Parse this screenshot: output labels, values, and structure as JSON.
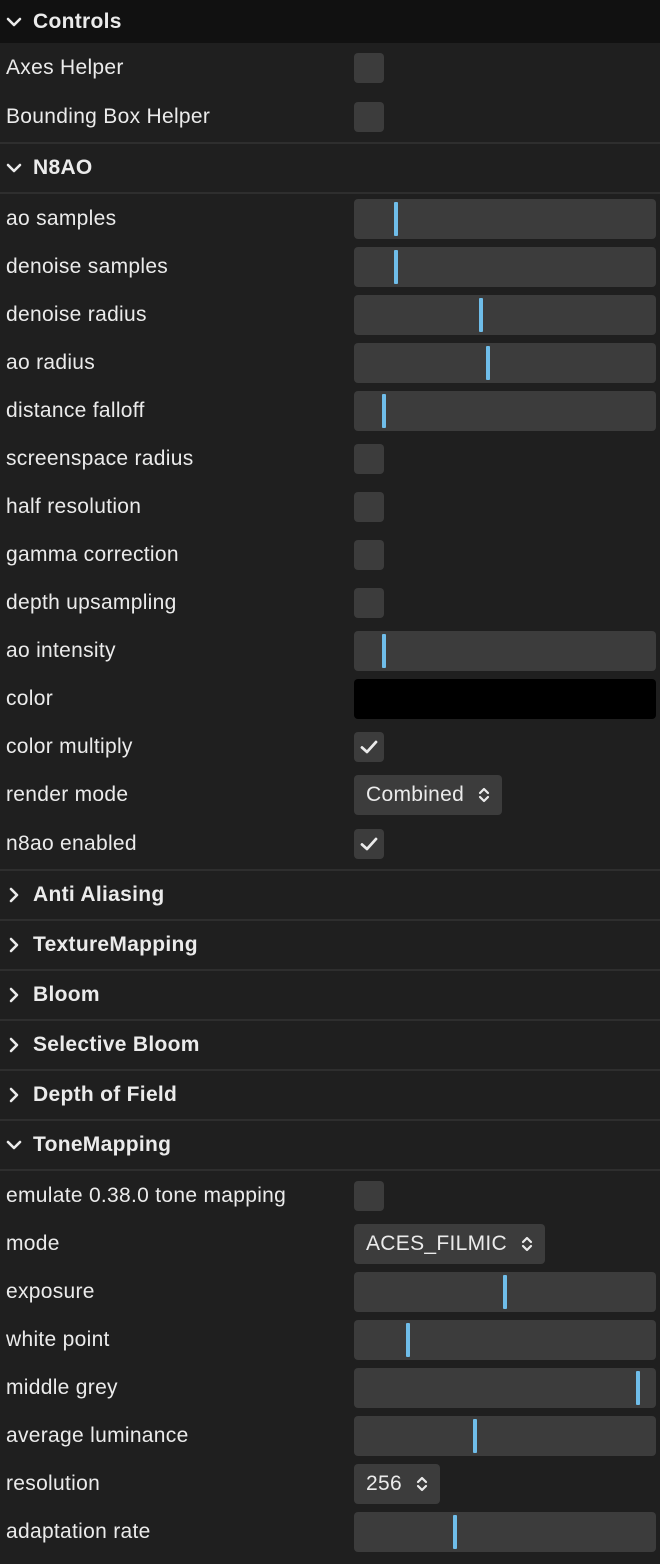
{
  "accent_color": "#6fbde9",
  "folders": {
    "controls": {
      "title": "Controls",
      "axes_helper": {
        "label": "Axes Helper",
        "checked": false
      },
      "bbox_helper": {
        "label": "Bounding Box Helper",
        "checked": false
      }
    },
    "n8ao": {
      "title": "N8AO",
      "ao_samples": {
        "label": "ao samples",
        "value_fraction": 0.14
      },
      "denoise_samples": {
        "label": "denoise samples",
        "value_fraction": 0.14
      },
      "denoise_radius": {
        "label": "denoise radius",
        "value_fraction": 0.42
      },
      "ao_radius": {
        "label": "ao radius",
        "value_fraction": 0.445
      },
      "distance_falloff": {
        "label": "distance falloff",
        "value_fraction": 0.1
      },
      "screenspace_radius": {
        "label": "screenspace radius",
        "checked": false
      },
      "half_resolution": {
        "label": "half resolution",
        "checked": false
      },
      "gamma_correction": {
        "label": "gamma correction",
        "checked": false
      },
      "depth_upsampling": {
        "label": "depth upsampling",
        "checked": false
      },
      "ao_intensity": {
        "label": "ao intensity",
        "value_fraction": 0.1
      },
      "color": {
        "label": "color",
        "value": "#000000"
      },
      "color_multiply": {
        "label": "color multiply",
        "checked": true
      },
      "render_mode": {
        "label": "render mode",
        "value": "Combined"
      },
      "n8ao_enabled": {
        "label": "n8ao enabled",
        "checked": true
      }
    },
    "anti_aliasing": {
      "title": "Anti Aliasing"
    },
    "texture_mapping": {
      "title": "TextureMapping"
    },
    "bloom": {
      "title": "Bloom"
    },
    "selective_bloom": {
      "title": "Selective Bloom"
    },
    "depth_of_field": {
      "title": "Depth of Field"
    },
    "tone_mapping": {
      "title": "ToneMapping",
      "emulate": {
        "label": "emulate 0.38.0 tone mapping",
        "checked": false
      },
      "mode": {
        "label": "mode",
        "value": "ACES_FILMIC"
      },
      "exposure": {
        "label": "exposure",
        "value_fraction": 0.5
      },
      "white_point": {
        "label": "white point",
        "value_fraction": 0.18
      },
      "middle_grey": {
        "label": "middle grey",
        "value_fraction": 0.94
      },
      "average_luminance": {
        "label": "average luminance",
        "value_fraction": 0.4
      },
      "resolution": {
        "label": "resolution",
        "value": "256"
      },
      "adaptation_rate": {
        "label": "adaptation rate",
        "value_fraction": 0.335
      }
    }
  }
}
